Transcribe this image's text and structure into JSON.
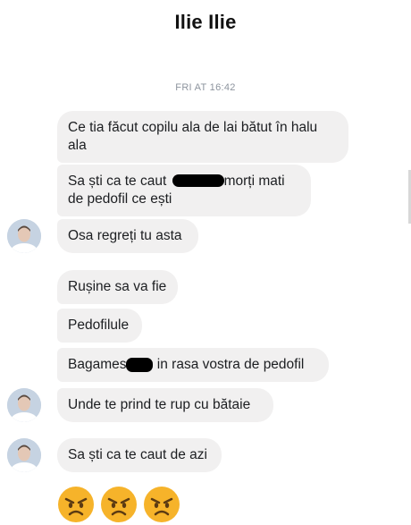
{
  "header": {
    "title": "Ilie Ilie"
  },
  "timestamp": "FRI AT 16:42",
  "messages": [
    {
      "text": "Ce tia făcut copilu ala de lai bătut în halu ala"
    },
    {
      "pre": "Sa ști ca te caut",
      "post": "morți mati de pedofil ce ești"
    },
    {
      "text": "Osa regreți tu asta"
    },
    {
      "text": "Rușine sa va fie"
    },
    {
      "text": "Pedofilule"
    },
    {
      "pre": "Bagames",
      "post": "in rasa vostra de pedofil"
    },
    {
      "text": "Unde te prind te rup cu bătaie"
    },
    {
      "text": "Sa ști ca te caut de azi"
    }
  ],
  "reactions": [
    {
      "icon": "angry-face-icon"
    },
    {
      "icon": "angry-face-icon"
    },
    {
      "icon": "angry-face-icon"
    }
  ],
  "colors": {
    "bubble": "#f1f0f0",
    "text": "#1c1e21",
    "timestamp": "#8d949e",
    "emoji": "#f6b32a"
  }
}
